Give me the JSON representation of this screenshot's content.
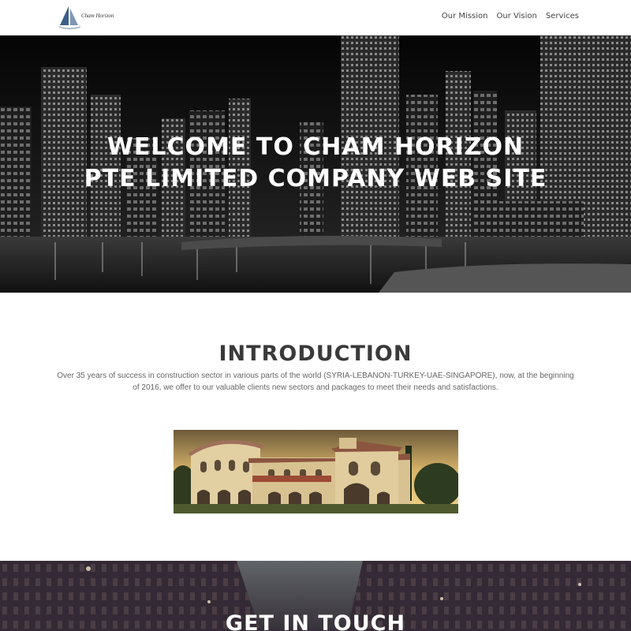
{
  "header": {
    "logo_text": "Cham Horizon",
    "nav": [
      {
        "label": "Our Mission"
      },
      {
        "label": "Our Vision"
      },
      {
        "label": "Services"
      }
    ]
  },
  "hero": {
    "title": "WELCOME TO CHAM HORIZON PTE LIMITED COMPANY WEB SITE"
  },
  "intro": {
    "title": "INTRODUCTION",
    "text": "Over 35 years of success in construction sector in various parts of the world (SYRIA-LEBANON-TURKEY-UAE-SINGAPORE), now, at the beginning of 2016, we offer to our valuable clients new sectors and packages to meet their needs and satisfactions."
  },
  "contact": {
    "title": "GET IN TOUCH"
  },
  "colors": {
    "logo_sail": "#3b5f8a",
    "text_dark": "#3a3a3a",
    "text_body": "#666666"
  }
}
